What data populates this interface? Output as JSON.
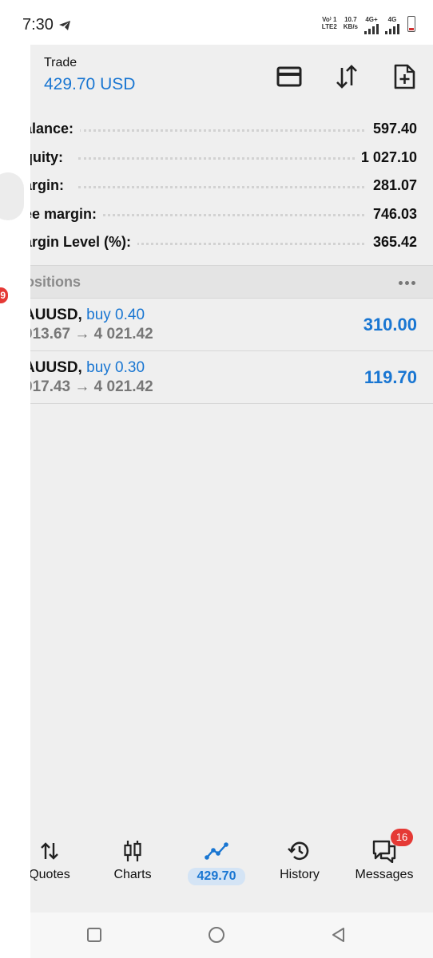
{
  "status_bar": {
    "time": "7:30",
    "volte_line1": "Vo⁾ 1",
    "volte_line2": "LTE2",
    "speed_value": "10.7",
    "speed_unit": "KB/s",
    "net1": "4G+",
    "net2": "4G",
    "battery_color": "#d32f2f"
  },
  "drawer": {
    "badge": "9"
  },
  "header": {
    "title": "Trade",
    "balance": "429.70 USD",
    "accent_color": "#1976d2"
  },
  "summary": [
    {
      "label": "alance:",
      "value": "597.40"
    },
    {
      "label": "quity:",
      "value": "1 027.10"
    },
    {
      "label": "argin:",
      "value": "281.07"
    },
    {
      "label": "ee margin:",
      "value": "746.03"
    },
    {
      "label": "argin Level (%):",
      "value": "365.42"
    }
  ],
  "positions_section": {
    "title": "ositions"
  },
  "positions": [
    {
      "symbol": "AUUSD,",
      "type": "buy 0.40",
      "prices": "013.67 → 4 021.42",
      "profit": "310.00"
    },
    {
      "symbol": "AUUSD,",
      "type": "buy 0.30",
      "prices": "017.43 → 4 021.42",
      "profit": "119.70"
    }
  ],
  "bottom_nav": {
    "quotes": "Quotes",
    "charts": "Charts",
    "trade": "429.70",
    "history": "History",
    "messages": "Messages",
    "messages_badge": "16"
  }
}
